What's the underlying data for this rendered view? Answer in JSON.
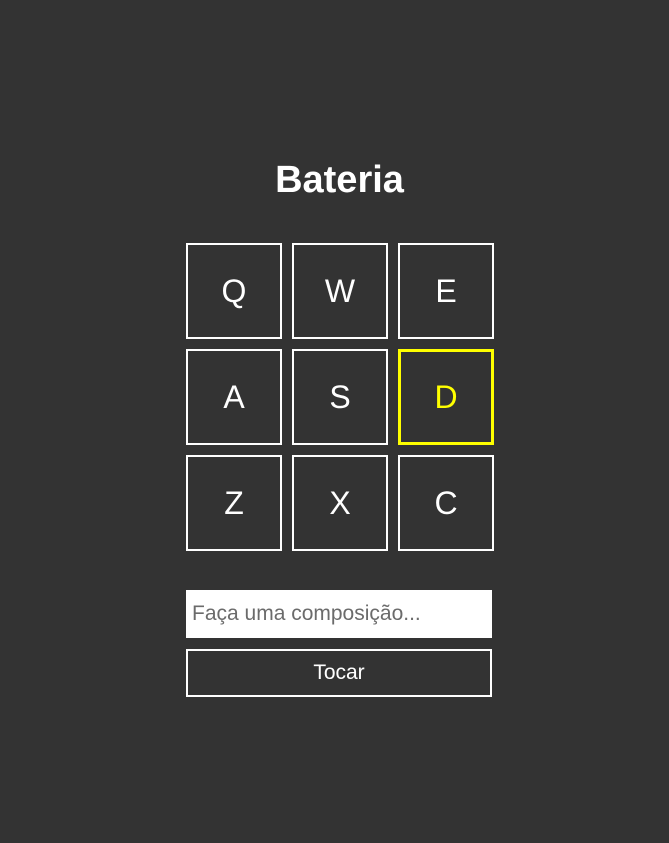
{
  "app": {
    "title": "Bateria"
  },
  "keys": [
    {
      "label": "Q",
      "active": false
    },
    {
      "label": "W",
      "active": false
    },
    {
      "label": "E",
      "active": false
    },
    {
      "label": "A",
      "active": false
    },
    {
      "label": "S",
      "active": false
    },
    {
      "label": "D",
      "active": true
    },
    {
      "label": "Z",
      "active": false
    },
    {
      "label": "X",
      "active": false
    },
    {
      "label": "C",
      "active": false
    }
  ],
  "composer": {
    "input_value": "",
    "input_placeholder": "Faça uma composição...",
    "play_label": "Tocar"
  },
  "colors": {
    "background": "#333333",
    "foreground": "#ffffff",
    "active_accent": "#ffff00"
  }
}
